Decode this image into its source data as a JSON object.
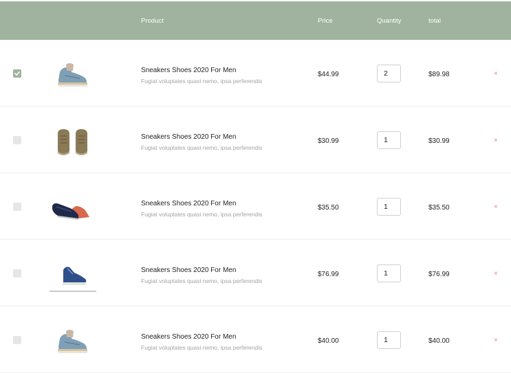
{
  "header": {
    "product": "Product",
    "price": "Price",
    "quantity": "Quantity",
    "total": "total"
  },
  "items": [
    {
      "checked": true,
      "name": "Sneakers Shoes 2020 For Men",
      "desc": "Fugiat voluptates quasi nemo, ipsa perferendis",
      "price": "$44.99",
      "qty": "2",
      "total": "$89.98",
      "remove": "×",
      "image": "light-blue-sneaker-image"
    },
    {
      "checked": false,
      "name": "Sneakers Shoes 2020 For Men",
      "desc": "Fugiat voluptates quasi nemo, ipsa perferendis",
      "price": "$30.99",
      "qty": "1",
      "total": "$30.99",
      "remove": "×",
      "image": "brown-boots-pair-image"
    },
    {
      "checked": false,
      "name": "Sneakers Shoes 2020 For Men",
      "desc": "Fugiat voluptates quasi nemo, ipsa perferendis",
      "price": "$35.50",
      "qty": "1",
      "total": "$35.50",
      "remove": "×",
      "image": "dark-loafer-orange-image"
    },
    {
      "checked": false,
      "name": "Sneakers Shoes 2020 For Men",
      "desc": "Fugiat voluptates quasi nemo, ipsa perferendis",
      "price": "$76.99",
      "qty": "1",
      "total": "$76.99",
      "remove": "×",
      "image": "navy-sneaker-image"
    },
    {
      "checked": false,
      "name": "Sneakers Shoes 2020 For Men",
      "desc": "Fugiat voluptates quasi nemo, ipsa perferendis",
      "price": "$40.00",
      "qty": "1",
      "total": "$40.00",
      "remove": "×",
      "image": "light-blue-sneaker-image"
    }
  ],
  "colors": {
    "header_bg": "#9fb39e",
    "checkbox_checked": "#9fb39e",
    "remove": "#e08a8a"
  }
}
